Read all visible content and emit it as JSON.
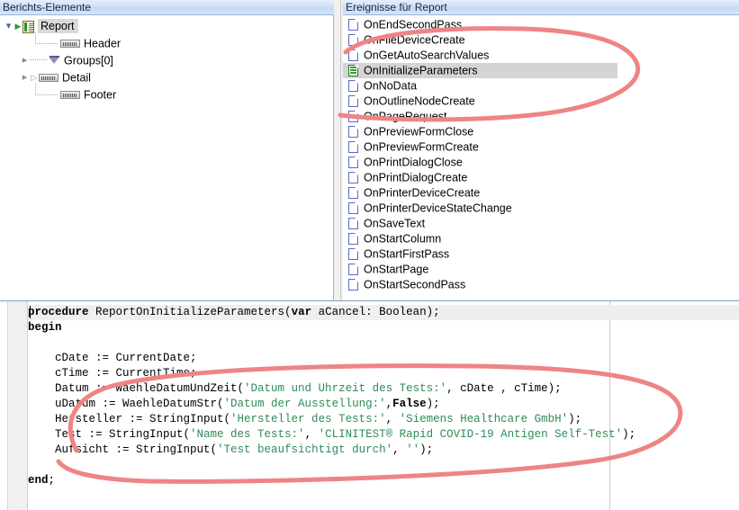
{
  "panels": {
    "left_title": "Berichts-Elemente",
    "right_title": "Ereignisse für Report"
  },
  "tree": {
    "root": {
      "label": "Report",
      "icon": "report-icon",
      "selected": true
    },
    "children": [
      {
        "label": "Header",
        "icon": "band-icon"
      },
      {
        "label": "Groups[0]",
        "icon": "group-icon"
      },
      {
        "label": "Detail",
        "icon": "band-icon"
      },
      {
        "label": "Footer",
        "icon": "band-icon"
      }
    ]
  },
  "events": {
    "selected": "OnInitializeParameters",
    "items": [
      "OnEndSecondPass",
      "OnFileDeviceCreate",
      "OnGetAutoSearchValues",
      "OnInitializeParameters",
      "OnNoData",
      "OnOutlineNodeCreate",
      "OnPageRequest",
      "OnPreviewFormClose",
      "OnPreviewFormCreate",
      "OnPrintDialogClose",
      "OnPrintDialogCreate",
      "OnPrinterDeviceCreate",
      "OnPrinterDeviceStateChange",
      "OnSaveText",
      "OnStartColumn",
      "OnStartFirstPass",
      "OnStartPage",
      "OnStartSecondPass"
    ]
  },
  "editor": {
    "lines": [
      "procedure ReportOnInitializeParameters(var aCancel: Boolean);",
      "begin",
      "",
      "    cDate := CurrentDate;",
      "    cTime := CurrentTime;",
      "    Datum := WaehleDatumUndZeit('Datum und Uhrzeit des Tests:', cDate , cTime);",
      "    uDatum := WaehleDatumStr('Datum der Ausstellung:',False);",
      "    Hersteller := StringInput('Hersteller des Tests:', 'Siemens Healthcare GmbH');",
      "    Test := StringInput('Name des Tests:', 'CLINITEST® Rapid COVID-19 Antigen Self-Test');",
      "    Aufsicht := StringInput('Test beaufsichtigt durch', '');",
      "",
      "end;"
    ],
    "highlighted_line": 0
  },
  "annotations": {
    "color": "#ef8484",
    "shapes": [
      "ellipse-around-event-list",
      "ellipse-around-code-block"
    ]
  }
}
